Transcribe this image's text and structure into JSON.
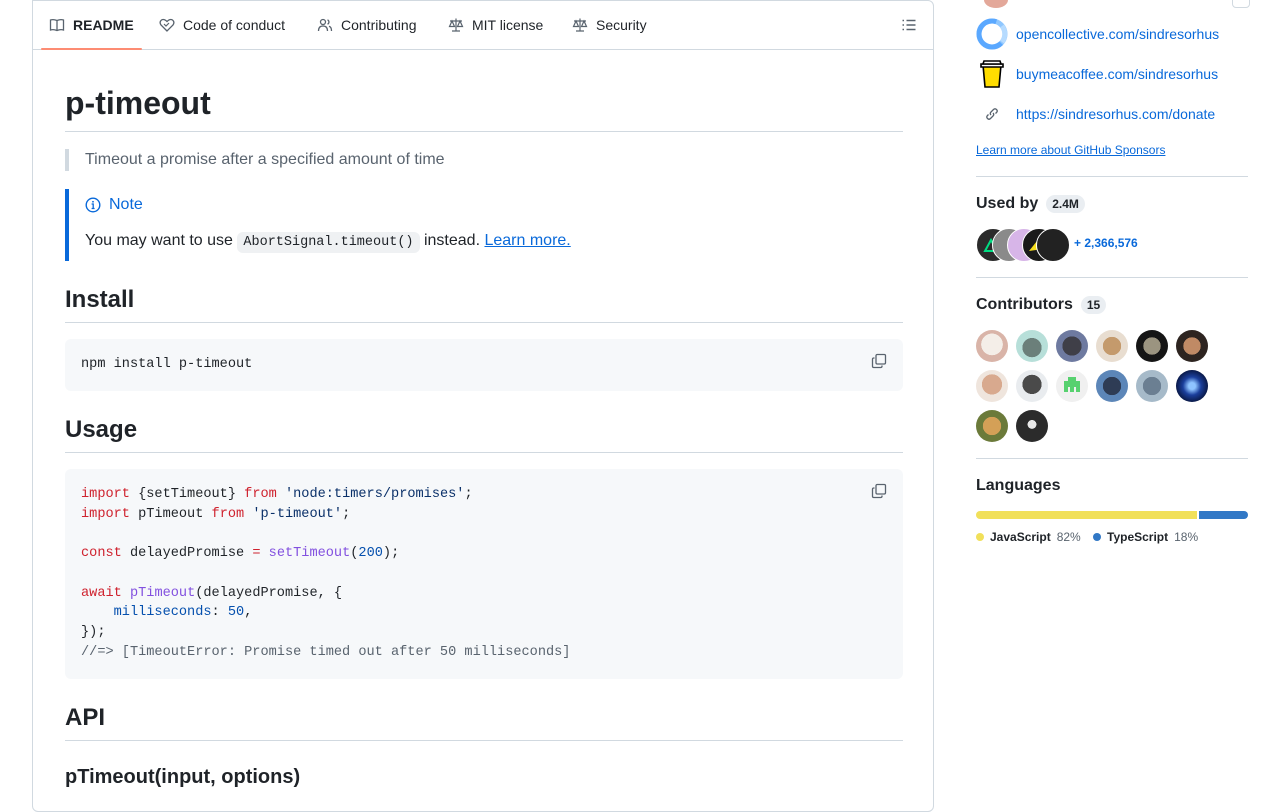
{
  "tabs": {
    "readme": "README",
    "code_of_conduct": "Code of conduct",
    "contributing": "Contributing",
    "license": "MIT license",
    "security": "Security"
  },
  "readme": {
    "title": "p-timeout",
    "tagline": "Timeout a promise after a specified amount of time",
    "note": {
      "title": "Note",
      "text_before": "You may want to use ",
      "code": "AbortSignal.timeout()",
      "text_after": " instead. ",
      "link": "Learn more."
    },
    "install_heading": "Install",
    "install_code": "npm install p-timeout",
    "usage_heading": "Usage",
    "usage_code": [
      [
        {
          "t": "import",
          "c": "kw"
        },
        {
          "t": " {setTimeout} "
        },
        {
          "t": "from",
          "c": "kw"
        },
        {
          "t": " "
        },
        {
          "t": "'node:timers/promises'",
          "c": "str"
        },
        {
          "t": ";"
        }
      ],
      [
        {
          "t": "import",
          "c": "kw"
        },
        {
          "t": " pTimeout "
        },
        {
          "t": "from",
          "c": "kw"
        },
        {
          "t": " "
        },
        {
          "t": "'p-timeout'",
          "c": "str"
        },
        {
          "t": ";"
        }
      ],
      [],
      [
        {
          "t": "const",
          "c": "kw"
        },
        {
          "t": " delayedPromise "
        },
        {
          "t": "=",
          "c": "kw"
        },
        {
          "t": " "
        },
        {
          "t": "setTimeout",
          "c": "fn"
        },
        {
          "t": "("
        },
        {
          "t": "200",
          "c": "num"
        },
        {
          "t": ");"
        }
      ],
      [],
      [
        {
          "t": "await",
          "c": "kw"
        },
        {
          "t": " "
        },
        {
          "t": "pTimeout",
          "c": "fn"
        },
        {
          "t": "(delayedPromise, {"
        }
      ],
      [
        {
          "t": "    "
        },
        {
          "t": "milliseconds",
          "c": "prop"
        },
        {
          "t": ": "
        },
        {
          "t": "50",
          "c": "num"
        },
        {
          "t": ","
        }
      ],
      [
        {
          "t": "});"
        }
      ],
      [
        {
          "t": "//=> [TimeoutError: Promise timed out after 50 milliseconds]",
          "c": "cm"
        }
      ]
    ],
    "api_heading": "API",
    "api_sub": "pTimeout(input, options)"
  },
  "sidebar": {
    "sponsors": [
      {
        "label": "opencollective.com/sindresorhus",
        "icon": "opencollective-icon"
      },
      {
        "label": "buymeacoffee.com/sindresorhus",
        "icon": "buymeacoffee-icon"
      },
      {
        "label": "https://sindresorhus.com/donate",
        "icon": "link-icon"
      }
    ],
    "learn_more": "Learn more about GitHub Sponsors",
    "used_by": {
      "heading": "Used by",
      "count": "2.4M",
      "more": "+ 2,366,576"
    },
    "contributors": {
      "heading": "Contributors",
      "count": "15"
    },
    "languages": {
      "heading": "Languages",
      "items": [
        {
          "name": "JavaScript",
          "percent": "82%",
          "value": 82,
          "color": "#f1e05a"
        },
        {
          "name": "TypeScript",
          "percent": "18%",
          "value": 18,
          "color": "#3178c6"
        }
      ]
    }
  }
}
